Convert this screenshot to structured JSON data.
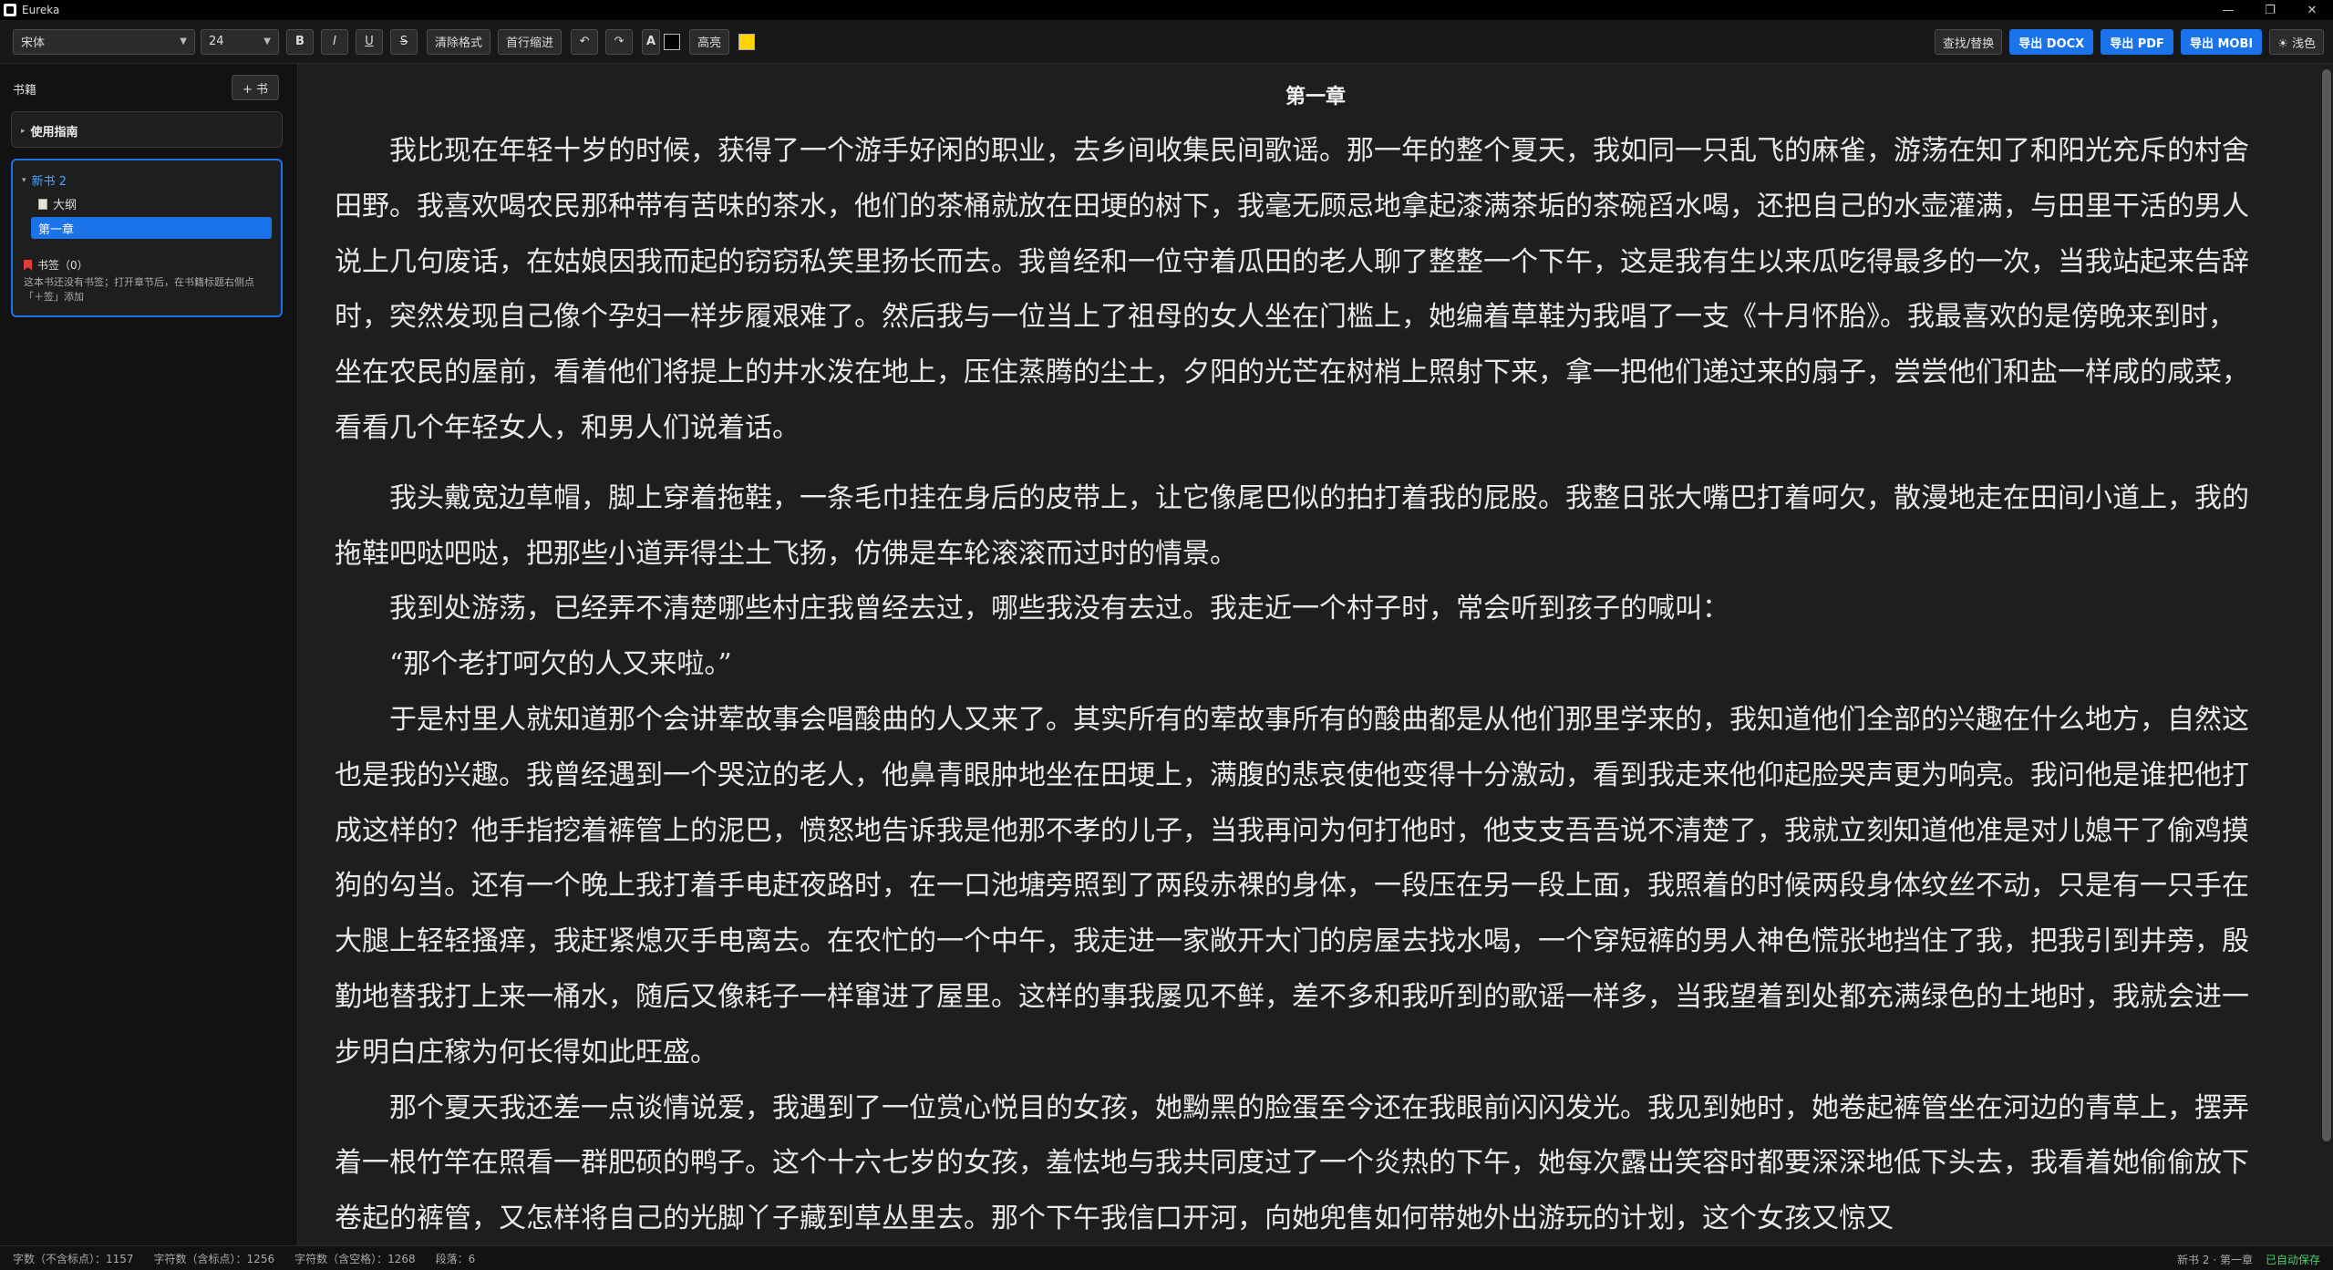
{
  "window": {
    "title": "Eureka"
  },
  "toolbar": {
    "font_family": "宋体",
    "font_size": "24",
    "bold": "B",
    "italic": "I",
    "underline": "U",
    "strike": "S",
    "clear_format": "清除格式",
    "indent": "首行缩进",
    "undo": "↶",
    "redo": "↷",
    "font_color": "A",
    "highlight": "高亮",
    "find_replace": "查找/替换",
    "export_docx": "导出 DOCX",
    "export_pdf": "导出 PDF",
    "export_mobi": "导出 MOBI",
    "theme": "☀ 浅色",
    "highlight_color": "#ffd400",
    "accent": "#1a73e8"
  },
  "sidebar": {
    "title": "书籍",
    "add_book": "+ 书",
    "guide": "使用指南",
    "book": {
      "name": "新书 2",
      "outline": "大纲",
      "chapter": "第一章",
      "bookmarks": "书签（0）",
      "hint": "这本书还没有书签；打开章节后，在书籍标题右侧点「＋签」添加"
    }
  },
  "editor": {
    "chapter_title": "第一章",
    "paragraphs": [
      "我比现在年轻十岁的时候，获得了一个游手好闲的职业，去乡间收集民间歌谣。那一年的整个夏天，我如同一只乱飞的麻雀，游荡在知了和阳光充斥的村舍田野。我喜欢喝农民那种带有苦味的茶水，他们的茶桶就放在田埂的树下，我毫无顾忌地拿起漆满茶垢的茶碗舀水喝，还把自己的水壶灌满，与田里干活的男人说上几句废话，在姑娘因我而起的窃窃私笑里扬长而去。我曾经和一位守着瓜田的老人聊了整整一个下午，这是我有生以来瓜吃得最多的一次，当我站起来告辞时，突然发现自己像个孕妇一样步履艰难了。然后我与一位当上了祖母的女人坐在门槛上，她编着草鞋为我唱了一支《十月怀胎》。我最喜欢的是傍晚来到时，坐在农民的屋前，看着他们将提上的井水泼在地上，压住蒸腾的尘土，夕阳的光芒在树梢上照射下来，拿一把他们递过来的扇子，尝尝他们和盐一样咸的咸菜，看看几个年轻女人，和男人们说着话。",
      "我头戴宽边草帽，脚上穿着拖鞋，一条毛巾挂在身后的皮带上，让它像尾巴似的拍打着我的屁股。我整日张大嘴巴打着呵欠，散漫地走在田间小道上，我的拖鞋吧哒吧哒，把那些小道弄得尘土飞扬，仿佛是车轮滚滚而过时的情景。",
      "我到处游荡，已经弄不清楚哪些村庄我曾经去过，哪些我没有去过。我走近一个村子时，常会听到孩子的喊叫：",
      "“那个老打呵欠的人又来啦。”",
      "于是村里人就知道那个会讲荤故事会唱酸曲的人又来了。其实所有的荤故事所有的酸曲都是从他们那里学来的，我知道他们全部的兴趣在什么地方，自然这也是我的兴趣。我曾经遇到一个哭泣的老人，他鼻青眼肿地坐在田埂上，满腹的悲哀使他变得十分激动，看到我走来他仰起脸哭声更为响亮。我问他是谁把他打成这样的？他手指挖着裤管上的泥巴，愤怒地告诉我是他那不孝的儿子，当我再问为何打他时，他支支吾吾说不清楚了，我就立刻知道他准是对儿媳干了偷鸡摸狗的勾当。还有一个晚上我打着手电赶夜路时，在一口池塘旁照到了两段赤裸的身体，一段压在另一段上面，我照着的时候两段身体纹丝不动，只是有一只手在大腿上轻轻搔痒，我赶紧熄灭手电离去。在农忙的一个中午，我走进一家敞开大门的房屋去找水喝，一个穿短裤的男人神色慌张地挡住了我，把我引到井旁，殷勤地替我打上来一桶水，随后又像耗子一样窜进了屋里。这样的事我屡见不鲜，差不多和我听到的歌谣一样多，当我望着到处都充满绿色的土地时，我就会进一步明白庄稼为何长得如此旺盛。",
      "那个夏天我还差一点谈情说爱，我遇到了一位赏心悦目的女孩，她黝黑的脸蛋至今还在我眼前闪闪发光。我见到她时，她卷起裤管坐在河边的青草上，摆弄着一根竹竿在照看一群肥硕的鸭子。这个十六七岁的女孩，羞怯地与我共同度过了一个炎热的下午，她每次露出笑容时都要深深地低下头去，我看着她偷偷放下卷起的裤管，又怎样将自己的光脚丫子藏到草丛里去。那个下午我信口开河，向她兜售如何带她外出游玩的计划，这个女孩又惊又"
    ]
  },
  "statusbar": {
    "chars_no_punct": "字数（不含标点）：1157",
    "chars_with_punct": "字符数（含标点）：1256",
    "chars_with_space": "字符数（含空格）：1268",
    "paragraphs": "段落：6",
    "location": "新书 2 · 第一章",
    "save_status": "已自动保存"
  }
}
